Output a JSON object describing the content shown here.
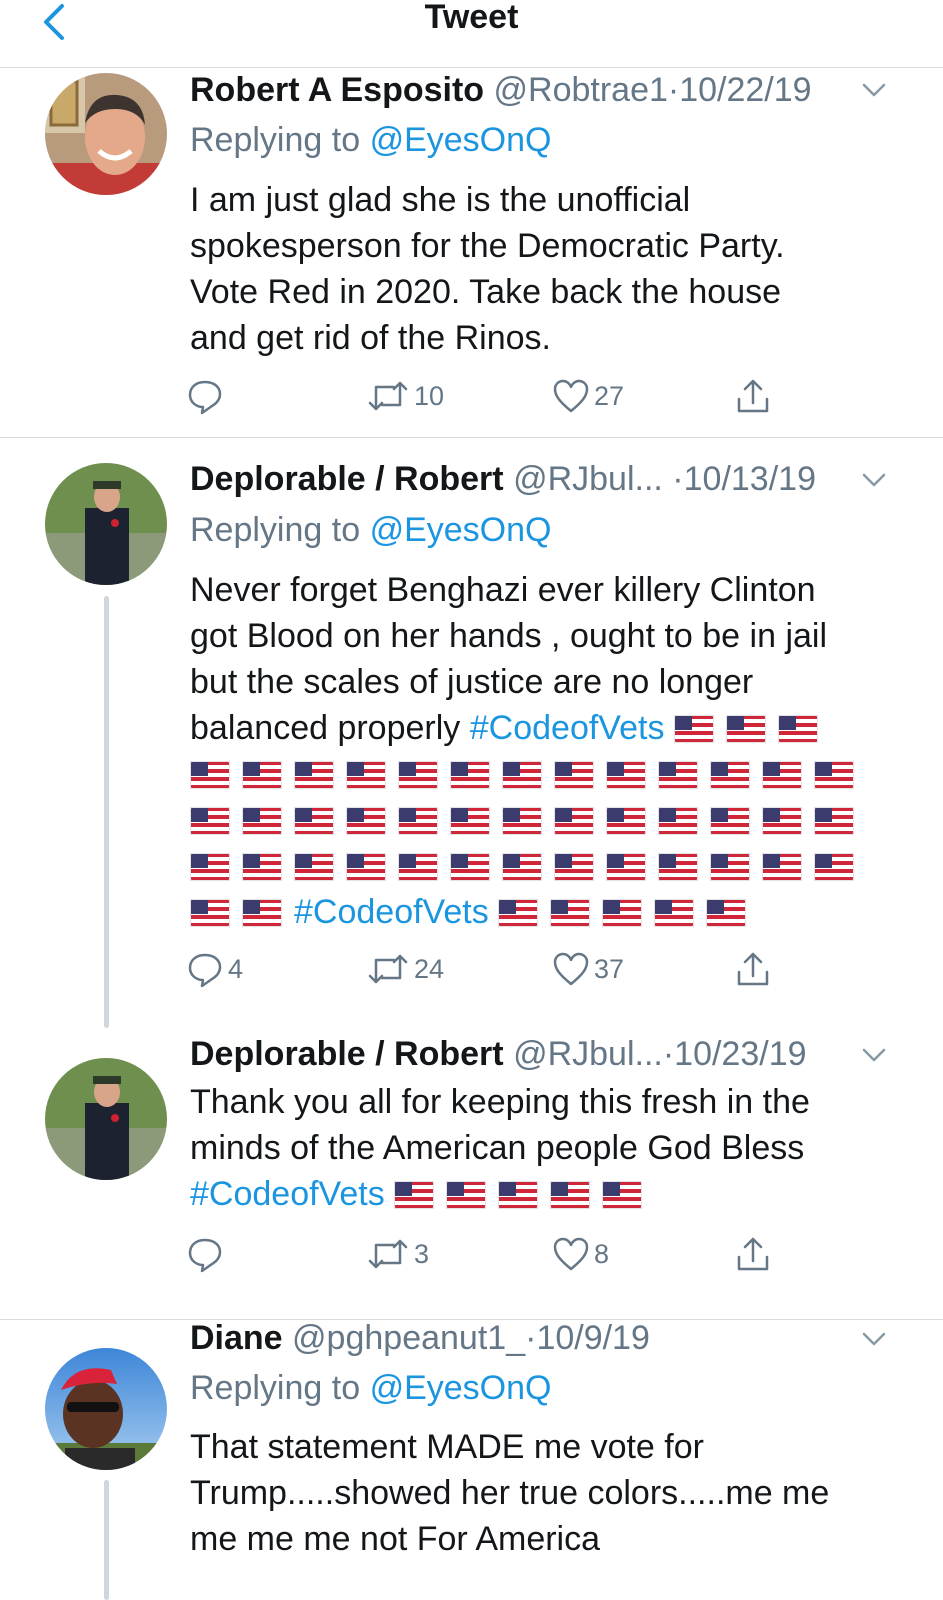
{
  "header": {
    "title": "Tweet",
    "back_icon": "chevron-left-icon"
  },
  "colors": {
    "link": "#1b95e0",
    "secondary": "#657786",
    "divider": "#d6dbe0"
  },
  "tweets": [
    {
      "name": "Robert A Esposito",
      "handle": "@Robtrae1",
      "sep": "·",
      "date": "10/22/19",
      "replying_prefix": "Replying to",
      "replying_to": "@EyesOnQ",
      "body_lines": [
        "I am just glad she is the unofficial",
        "spokesperson for the Democratic Party.",
        "Vote Red in 2020. Take back the house",
        "and get rid of the Rinos."
      ],
      "replies": "",
      "retweets": "10",
      "likes": "27"
    },
    {
      "name": "Deplorable / Robert",
      "handle": "@RJbul...",
      "sep": "·",
      "date": "10/13/19",
      "replying_prefix": "Replying to",
      "replying_to": "@EyesOnQ",
      "body_lines": [
        "Never forget Benghazi ever killery Clinton",
        "got Blood on her hands , ought to be in jail",
        "but the scales of justice are no longer",
        "balanced properly"
      ],
      "hashtag_1": "#CodeofVets",
      "hashtag_2": "#CodeofVets",
      "flag_icon": "us-flag-emoji",
      "replies": "4",
      "retweets": "24",
      "likes": "37"
    },
    {
      "name": "Deplorable / Robert",
      "handle": "@RJbul...",
      "sep": "·",
      "date": "10/23/19",
      "body_lines": [
        "Thank you all for keeping this fresh in the",
        "minds of the American people God Bless"
      ],
      "hashtag_1": "#CodeofVets",
      "replies": "",
      "retweets": "3",
      "likes": "8"
    },
    {
      "name": "Diane",
      "handle": "@pghpeanut1_",
      "sep": "·",
      "date": "10/9/19",
      "replying_prefix": "Replying to",
      "replying_to": "@EyesOnQ",
      "body_lines": [
        "That statement MADE me vote for",
        "Trump.....showed her true colors.....me me",
        "me me me not For America"
      ]
    }
  ]
}
